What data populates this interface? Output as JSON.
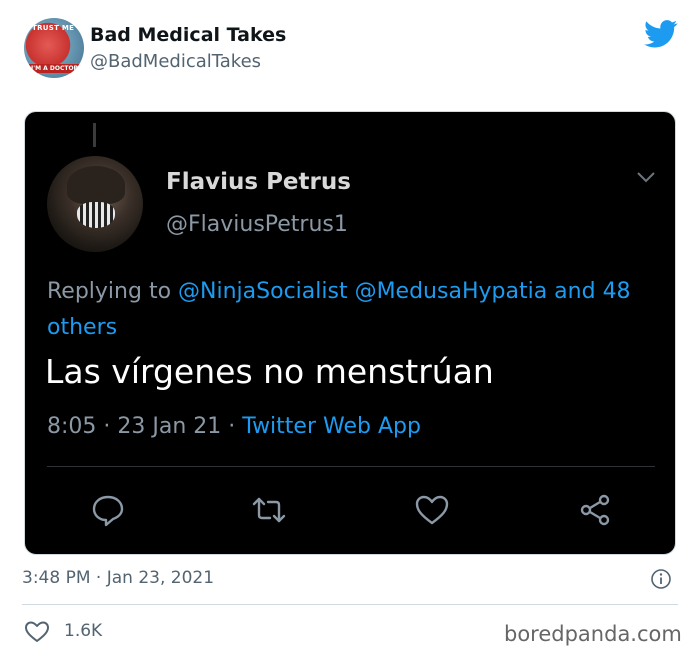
{
  "tweet": {
    "author": {
      "display_name": "Bad Medical Takes",
      "handle": "@BadMedicalTakes",
      "avatar_badge_top": "TRUST ME",
      "avatar_badge_bottom": "I'M A DOCTOR"
    },
    "timestamp": "3:48 PM · Jan 23, 2021",
    "like_count": "1.6K",
    "brand_color": "#1d9bf0"
  },
  "embedded": {
    "author": {
      "display_name": "Flavius Petrus",
      "handle": "@FlaviusPetrus1"
    },
    "replying": {
      "prefix": "Replying to ",
      "mention_1": "@NinjaSocialist",
      "mention_2": "@MedusaHypatia",
      "suffix": " and 48 others"
    },
    "text": "Las vírgenes no menstrúan",
    "time": "8:05",
    "date": "23 Jan 21",
    "separator": " · ",
    "app": "Twitter Web App",
    "actions": [
      "reply-icon",
      "retweet-icon",
      "like-icon",
      "share-icon"
    ]
  },
  "watermark": "boredpanda.com"
}
